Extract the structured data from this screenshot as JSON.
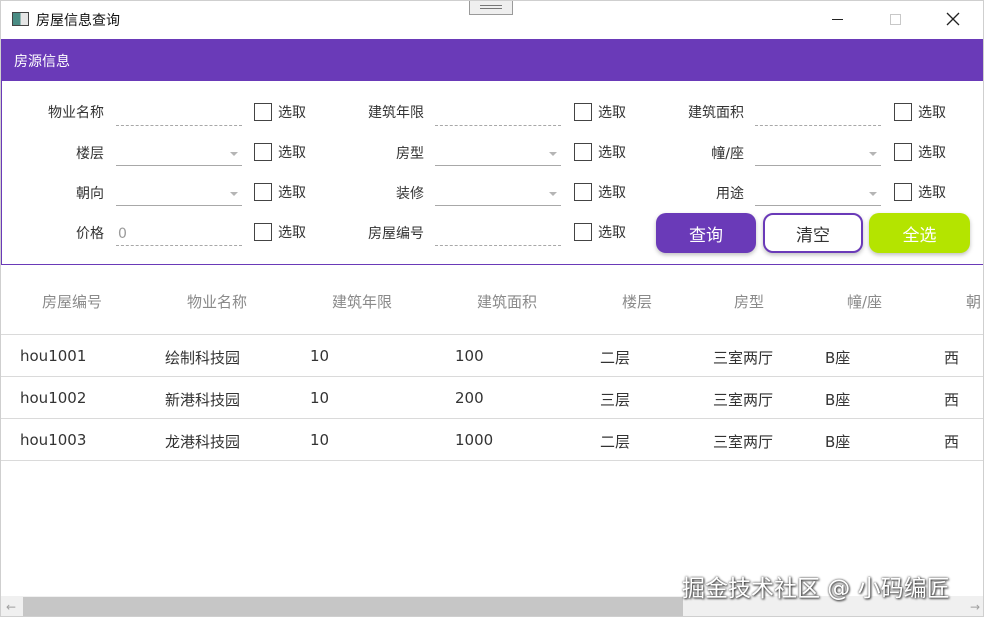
{
  "window": {
    "title": "房屋信息查询"
  },
  "group": {
    "title": "房源信息",
    "checkbox_label": "选取",
    "fields": {
      "property_name": {
        "label": "物业名称",
        "value": ""
      },
      "build_year": {
        "label": "建筑年限",
        "value": ""
      },
      "build_area": {
        "label": "建筑面积",
        "value": ""
      },
      "floor": {
        "label": "楼层",
        "value": ""
      },
      "room_type": {
        "label": "房型",
        "value": ""
      },
      "building": {
        "label": "幢/座",
        "value": ""
      },
      "orientation": {
        "label": "朝向",
        "value": ""
      },
      "decoration": {
        "label": "装修",
        "value": ""
      },
      "usage": {
        "label": "用途",
        "value": ""
      },
      "price": {
        "label": "价格",
        "value": "0"
      },
      "house_no": {
        "label": "房屋编号",
        "value": ""
      }
    },
    "buttons": {
      "query": "查询",
      "clear": "清空",
      "select_all": "全选"
    }
  },
  "table": {
    "columns": [
      "房屋编号",
      "物业名称",
      "建筑年限",
      "建筑面积",
      "楼层",
      "房型",
      "幢/座",
      "朝"
    ],
    "rows": [
      [
        "hou1001",
        "绘制科技园",
        "10",
        "100",
        "二层",
        "三室两厅",
        "B座",
        "西"
      ],
      [
        "hou1002",
        "新港科技园",
        "10",
        "200",
        "三层",
        "三室两厅",
        "B座",
        "西"
      ],
      [
        "hou1003",
        "龙港科技园",
        "10",
        "1000",
        "二层",
        "三室两厅",
        "B座",
        "西"
      ]
    ]
  },
  "scrollbar": {
    "left_arrow": "←",
    "right_arrow": "→"
  },
  "watermark": "掘金技术社区 @ 小码编匠",
  "colors": {
    "accent": "#6a3ab8",
    "select_all": "#b4e400"
  }
}
